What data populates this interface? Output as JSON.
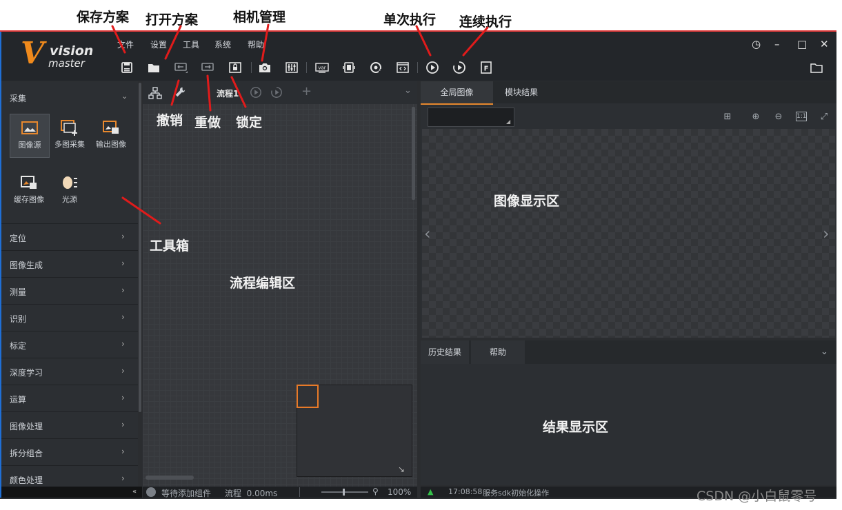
{
  "menu": [
    "文件",
    "设置",
    "工具",
    "系统",
    "帮助"
  ],
  "logo": {
    "line1": "vision",
    "line2": "master"
  },
  "window_controls": {
    "history": "◷",
    "minimize": "–",
    "maximize": "□",
    "close": "✕"
  },
  "toolbox": {
    "header": "采集",
    "tools": [
      "图像源",
      "多图采集",
      "输出图像",
      "缓存图像",
      "光源"
    ],
    "categories": [
      "定位",
      "图像生成",
      "测量",
      "识别",
      "标定",
      "深度学习",
      "运算",
      "图像处理",
      "拆分组合",
      "颜色处理"
    ]
  },
  "flow": {
    "tab_label": "流程1",
    "add_tab": "+",
    "collapse": "⌄"
  },
  "image_panel": {
    "tabs": [
      "全局图像",
      "模块结果"
    ]
  },
  "result_panel": {
    "tabs": [
      "历史结果",
      "帮助"
    ]
  },
  "status": {
    "left": "等待添加组件",
    "flow_time": "流程  0.00ms",
    "zoom": "100%",
    "right_time": "17:08:58",
    "right_msg": "服务sdk初始化操作"
  },
  "annotations": {
    "save": "保存方案",
    "open": "打开方案",
    "camera": "相机管理",
    "run_once": "单次执行",
    "run_cont": "连续执行",
    "undo": "撤销",
    "redo": "重做",
    "lock": "锁定",
    "toolbox": "工具箱",
    "flow_area": "流程编辑区",
    "image_area": "图像显示区",
    "result_area": "结果显示区"
  },
  "watermark": "CSDN @小白鼠零号",
  "colors": {
    "accent": "#e8882d",
    "logo": "#f08a1c",
    "annotation_arrow": "#e01b1b"
  }
}
